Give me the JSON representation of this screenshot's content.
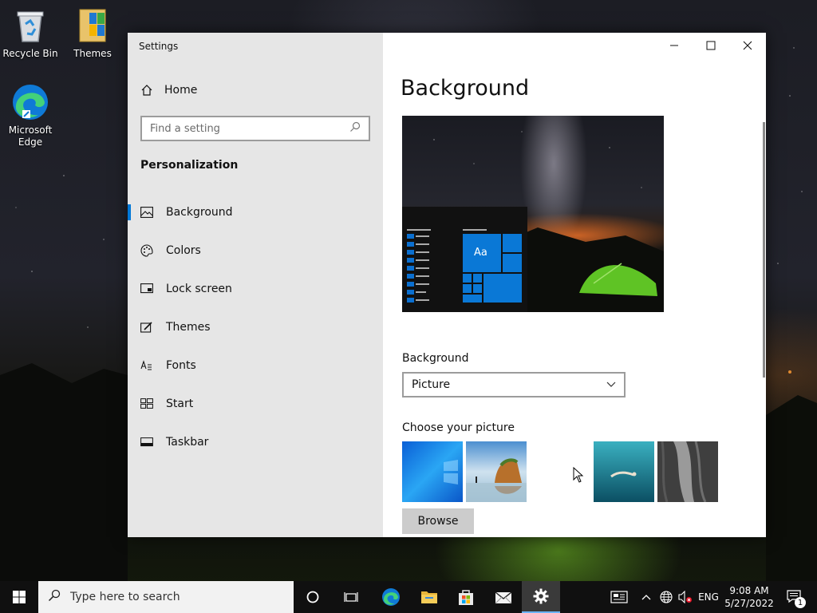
{
  "desktop": {
    "icons": [
      {
        "label": "Recycle Bin",
        "icon": "recycle-bin-icon"
      },
      {
        "label": "Themes",
        "icon": "folder-themes-icon"
      },
      {
        "label": "Microsoft Edge",
        "icon": "edge-icon"
      }
    ]
  },
  "window": {
    "title": "Settings",
    "controls": {
      "minimize": "—",
      "maximize": "☐",
      "close": "✕"
    },
    "home_label": "Home",
    "search_placeholder": "Find a setting",
    "section_title": "Personalization",
    "nav": [
      {
        "label": "Background",
        "icon": "picture-icon",
        "active": true
      },
      {
        "label": "Colors",
        "icon": "palette-icon",
        "active": false
      },
      {
        "label": "Lock screen",
        "icon": "lock-screen-icon",
        "active": false
      },
      {
        "label": "Themes",
        "icon": "brush-icon",
        "active": false
      },
      {
        "label": "Fonts",
        "icon": "fonts-icon",
        "active": false
      },
      {
        "label": "Start",
        "icon": "start-icon",
        "active": false
      },
      {
        "label": "Taskbar",
        "icon": "taskbar-icon",
        "active": false
      }
    ],
    "page_title": "Background",
    "preview_tile_text": "Aa",
    "background_label": "Background",
    "background_value": "Picture",
    "choose_picture_label": "Choose your picture",
    "browse_label": "Browse"
  },
  "taskbar": {
    "search_placeholder": "Type here to search",
    "language": "ENG",
    "time": "9:08 AM",
    "date": "5/27/2022",
    "notification_count": "1"
  },
  "colors": {
    "accent": "#0078d7",
    "sidebar_bg": "#e6e6e6",
    "taskbar_bg": "#101010"
  }
}
